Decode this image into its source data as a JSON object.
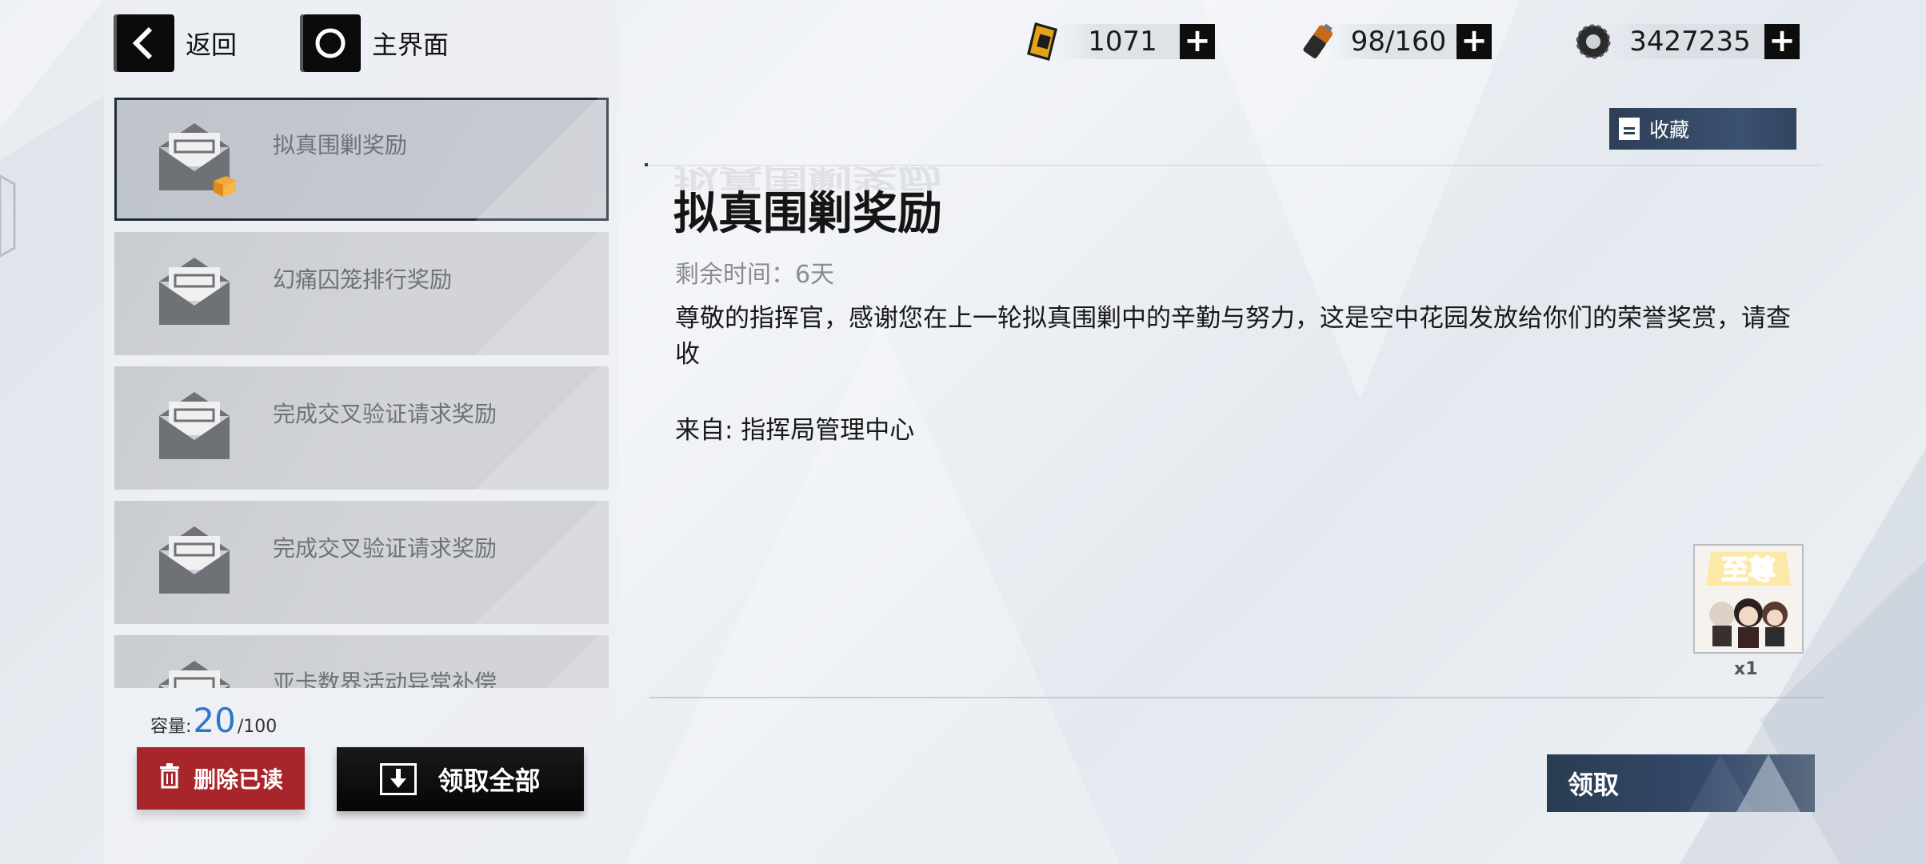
{
  "nav": {
    "back_label": "返回",
    "home_label": "主界面"
  },
  "resources": [
    {
      "icon": "ticket-icon",
      "value": "1071"
    },
    {
      "icon": "battery-icon",
      "value": "98/160"
    },
    {
      "icon": "gear-coin-icon",
      "value": "3427235"
    }
  ],
  "mail_list": {
    "items": [
      {
        "title": "拟真围剿奖励",
        "selected": true,
        "has_attachment": true
      },
      {
        "title": "幻痛囚笼排行奖励"
      },
      {
        "title": "完成交叉验证请求奖励"
      },
      {
        "title": "完成交叉验证请求奖励"
      },
      {
        "title": "亚卡数界活动异常补偿"
      }
    ]
  },
  "capacity": {
    "label": "容量:",
    "value": "20",
    "max": "/100"
  },
  "buttons": {
    "delete_read": "删除已读",
    "claim_all": "领取全部",
    "favorite": "收藏",
    "claim": "领取"
  },
  "detail": {
    "title": "拟真围剿奖励",
    "remaining": "剩余时间：6天",
    "body": "尊敬的指挥官，感谢您在上一轮拟真围剿中的辛勤与努力，这是空中花园发放给你们的荣誉奖赏，请查收",
    "sender": "来自: 指挥局管理中心",
    "reward": {
      "badge_text": "至尊",
      "quantity": "x1"
    }
  },
  "colors": {
    "accent_blue": "#2f76c9",
    "delete_red": "#a8262b",
    "nav_dark": "#0b0b0b",
    "button_navy": "#2d3f56"
  }
}
